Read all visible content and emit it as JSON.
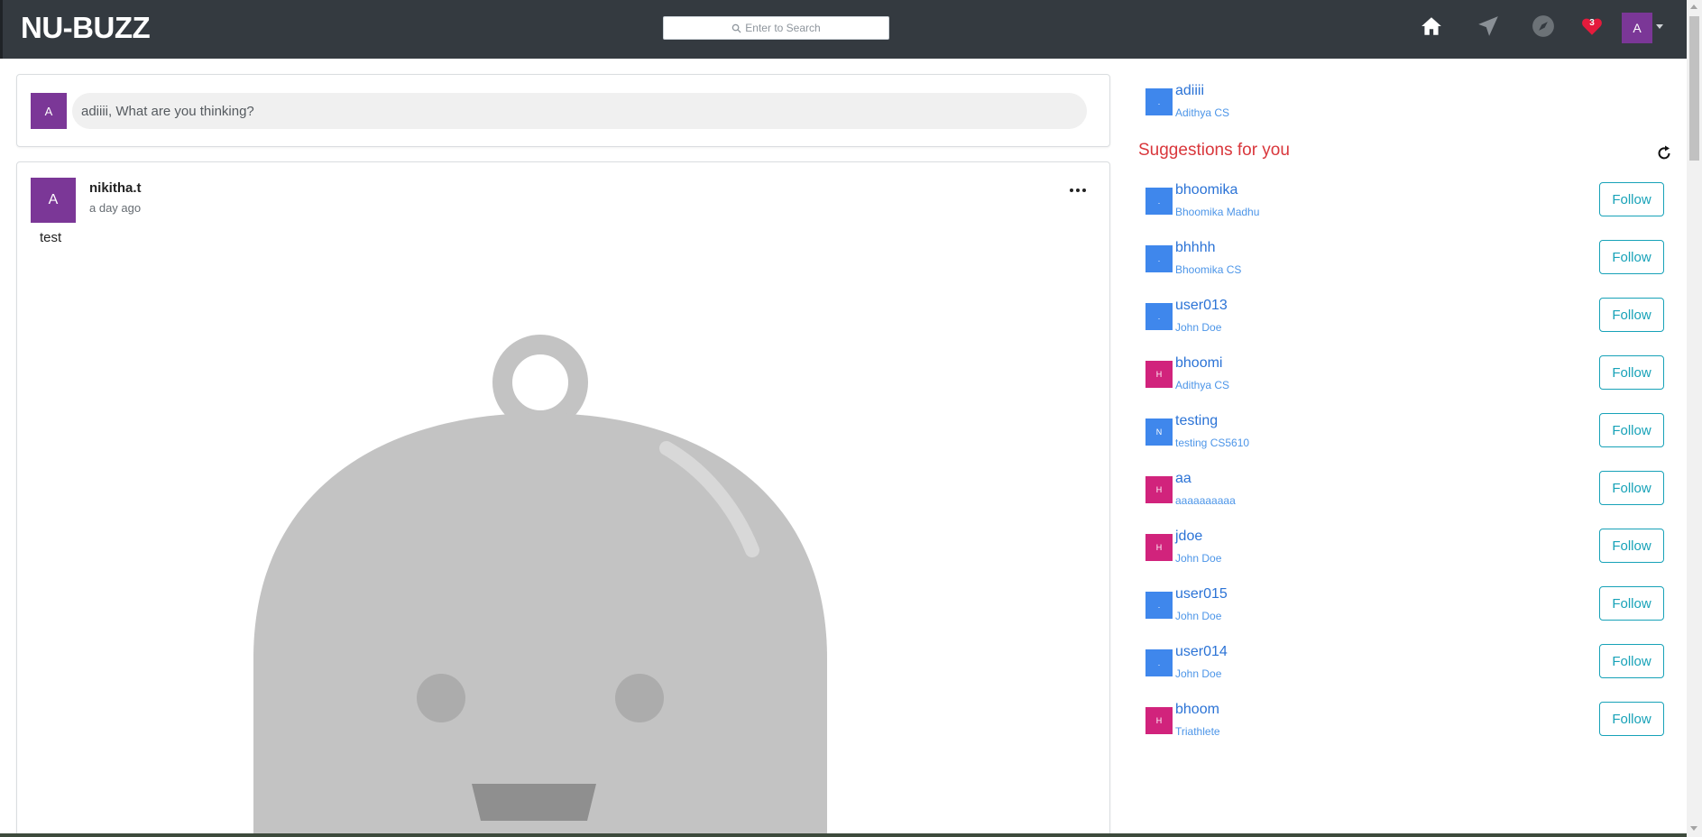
{
  "navbar": {
    "brand": "NU-BUZZ",
    "search_placeholder": "Enter to Search",
    "notification_count": "3",
    "user_initial": "A"
  },
  "composer": {
    "avatar_initial": "A",
    "prompt": "adiiii, What are you thinking?"
  },
  "post": {
    "avatar_initial": "A",
    "author": "nikitha.t",
    "time": "a day ago",
    "text": "test"
  },
  "sidebar": {
    "me": {
      "username": "adiiii",
      "fullname": "Adithya CS",
      "avatar_initial": ".",
      "avatar_color": "#3f87ec"
    },
    "suggestions_title": "Suggestions for you",
    "follow_label": "Follow",
    "suggestions": [
      {
        "username": "bhoomika",
        "fullname": "Bhoomika Madhu",
        "avatar_initial": ".",
        "avatar_color": "#3f87ec"
      },
      {
        "username": "bhhhh",
        "fullname": "Bhoomika CS",
        "avatar_initial": ".",
        "avatar_color": "#3f87ec"
      },
      {
        "username": "user013",
        "fullname": "John Doe",
        "avatar_initial": ".",
        "avatar_color": "#3f87ec"
      },
      {
        "username": "bhoomi",
        "fullname": "Adithya CS",
        "avatar_initial": "H",
        "avatar_color": "#d1237c"
      },
      {
        "username": "testing",
        "fullname": "testing CS5610",
        "avatar_initial": "N",
        "avatar_color": "#3f87ec"
      },
      {
        "username": "aa",
        "fullname": "aaaaaaaaaa",
        "avatar_initial": "H",
        "avatar_color": "#d1237c"
      },
      {
        "username": "jdoe",
        "fullname": "John Doe",
        "avatar_initial": "H",
        "avatar_color": "#d1237c"
      },
      {
        "username": "user015",
        "fullname": "John Doe",
        "avatar_initial": ".",
        "avatar_color": "#3f87ec"
      },
      {
        "username": "user014",
        "fullname": "John Doe",
        "avatar_initial": ".",
        "avatar_color": "#3f87ec"
      },
      {
        "username": "bhoom",
        "fullname": "Triathlete",
        "avatar_initial": "H",
        "avatar_color": "#d1237c"
      }
    ]
  },
  "colors": {
    "navbar": "#343a40",
    "accent_purple": "#7b3797",
    "link_blue": "#2b73d6",
    "suggestions_red": "#d9373c",
    "follow_teal": "#17a2b8"
  }
}
